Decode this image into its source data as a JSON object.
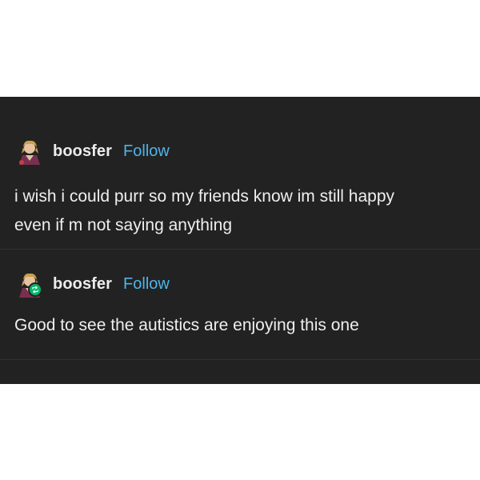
{
  "posts": [
    {
      "username": "boosfer",
      "follow_label": "Follow",
      "text_lines": [
        "i wish i could purr so my friends know im still happy",
        "even if m not saying anything"
      ],
      "reblog": false
    },
    {
      "username": "boosfer",
      "follow_label": "Follow",
      "text_lines": [
        "Good to see the autistics are enjoying this one"
      ],
      "reblog": true
    }
  ],
  "colors": {
    "background": "#222222",
    "text": "#efefef",
    "follow": "#4fb4e9",
    "reblog_badge": "#00b86b"
  },
  "icons": {
    "avatar": "avatar-icon",
    "reblog": "reblog-icon"
  }
}
